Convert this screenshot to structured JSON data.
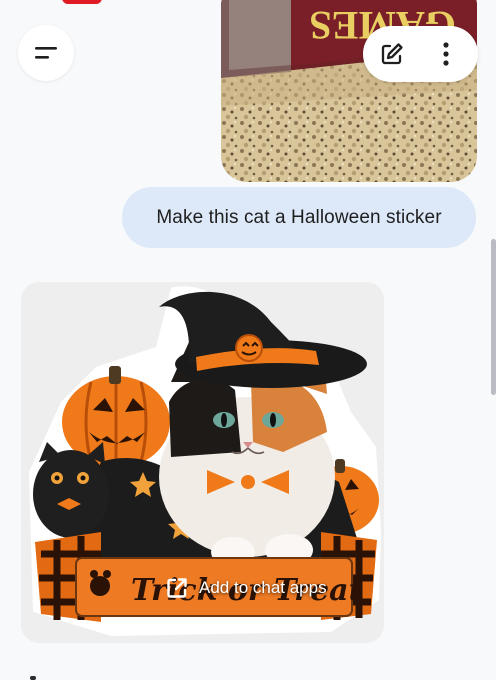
{
  "chat": {
    "user_message": "Make this cat a Halloween sticker",
    "photo_box_text": "GAMES",
    "sticker": {
      "banner_text": "Trick or Treat",
      "action_label": "Add to chat apps"
    }
  },
  "icons": {
    "menu": "menu-icon",
    "edit": "edit-icon",
    "more": "more-vertical-icon",
    "share": "open-external-icon"
  },
  "colors": {
    "accent_bubble": "#dde9f8",
    "pumpkin": "#f07a1a",
    "alert_red": "#e01b24"
  }
}
